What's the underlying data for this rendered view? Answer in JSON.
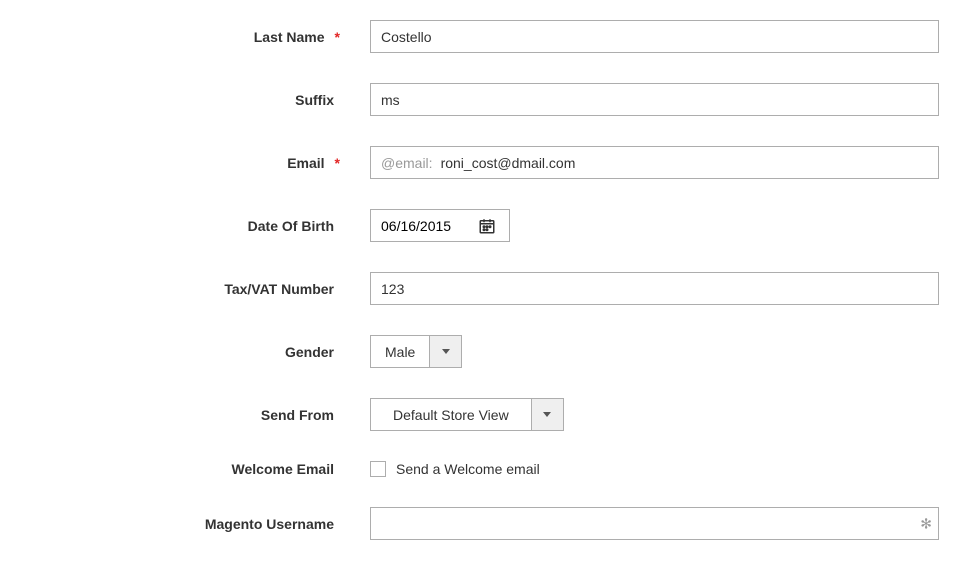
{
  "fields": {
    "lastName": {
      "label": "Last Name",
      "required": true,
      "value": "Costello"
    },
    "suffix": {
      "label": "Suffix",
      "required": false,
      "value": "ms"
    },
    "email": {
      "label": "Email",
      "required": true,
      "prefix": "@email:",
      "value": "roni_cost@dmail.com"
    },
    "dob": {
      "label": "Date Of Birth",
      "required": false,
      "value": "06/16/2015"
    },
    "taxvat": {
      "label": "Tax/VAT Number",
      "required": false,
      "value": "123"
    },
    "gender": {
      "label": "Gender",
      "required": false,
      "value": "Male"
    },
    "sendFrom": {
      "label": "Send From",
      "required": false,
      "value": "Default Store View"
    },
    "welcomeEmail": {
      "label": "Welcome Email",
      "required": false,
      "checkboxLabel": "Send a Welcome email",
      "checked": false
    },
    "magentoUsername": {
      "label": "Magento Username",
      "required": false,
      "value": ""
    }
  }
}
